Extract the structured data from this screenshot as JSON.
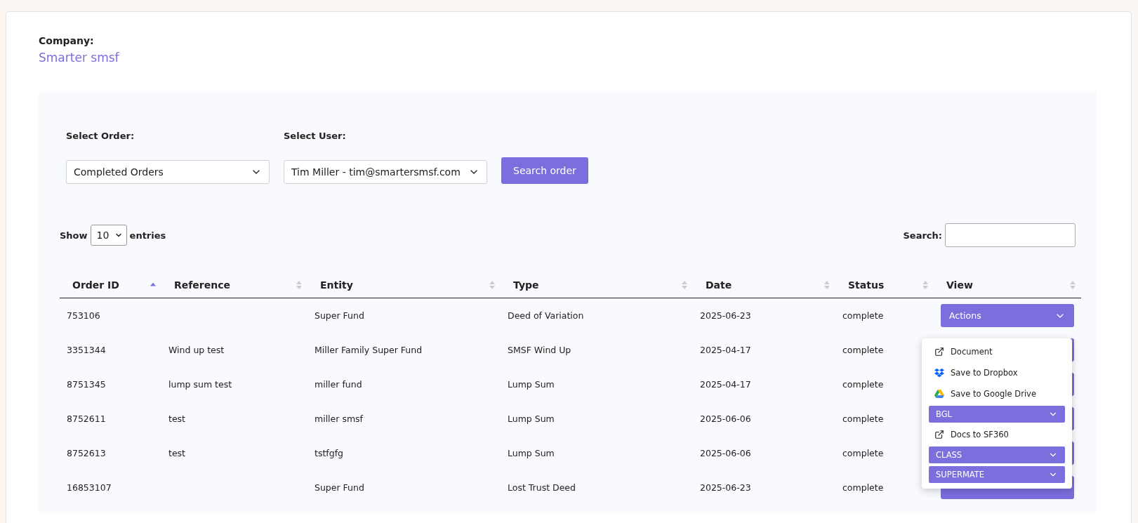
{
  "company": {
    "label": "Company:",
    "value": "Smarter smsf"
  },
  "filters": [
    {
      "label": "Select Order:",
      "value": "Completed Orders"
    },
    {
      "label": "Select User:",
      "value": "Tim Miller - tim@smartersmsf.com"
    }
  ],
  "search_order_button": "Search order",
  "length": {
    "show": "Show",
    "value": "10",
    "entries": "entries"
  },
  "search": {
    "label": "Search:"
  },
  "table": {
    "columns": [
      {
        "label": "Order ID",
        "sorted": true
      },
      {
        "label": "Reference",
        "sorted": false
      },
      {
        "label": "Entity",
        "sorted": false
      },
      {
        "label": "Type",
        "sorted": false
      },
      {
        "label": "Date",
        "sorted": false
      },
      {
        "label": "Status",
        "sorted": false
      },
      {
        "label": "View",
        "sorted": false
      }
    ],
    "rows": [
      {
        "cells": [
          "753106",
          "",
          "Super Fund",
          "Deed of Variation",
          "2025-06-23",
          "complete"
        ],
        "action": "Actions"
      },
      {
        "cells": [
          "3351344",
          "Wind up test",
          "Miller Family Super Fund",
          "SMSF Wind Up",
          "2025-04-17",
          "complete"
        ]
      },
      {
        "cells": [
          "8751345",
          "lump sum test",
          "miller fund",
          "Lump Sum",
          "2025-04-17",
          "complete"
        ]
      },
      {
        "cells": [
          "8752611",
          "test",
          "miller smsf",
          "Lump Sum",
          "2025-06-06",
          "complete"
        ]
      },
      {
        "cells": [
          "8752613",
          "test",
          "tstfgfg",
          "Lump Sum",
          "2025-06-06",
          "complete"
        ]
      },
      {
        "cells": [
          "16853107",
          "",
          "Super Fund",
          "Lost Trust Deed",
          "2025-06-23",
          "complete"
        ]
      }
    ]
  },
  "actions_menu": [
    {
      "kind": "external",
      "label": "Document"
    },
    {
      "kind": "dropbox",
      "label": "Save to Dropbox"
    },
    {
      "kind": "drive",
      "label": "Save to Google Drive"
    },
    {
      "kind": "submenu",
      "label": "BGL"
    },
    {
      "kind": "external",
      "label": "Docs to SF360"
    },
    {
      "kind": "submenu",
      "label": "CLASS"
    },
    {
      "kind": "submenu",
      "label": "SUPERMATE"
    }
  ]
}
